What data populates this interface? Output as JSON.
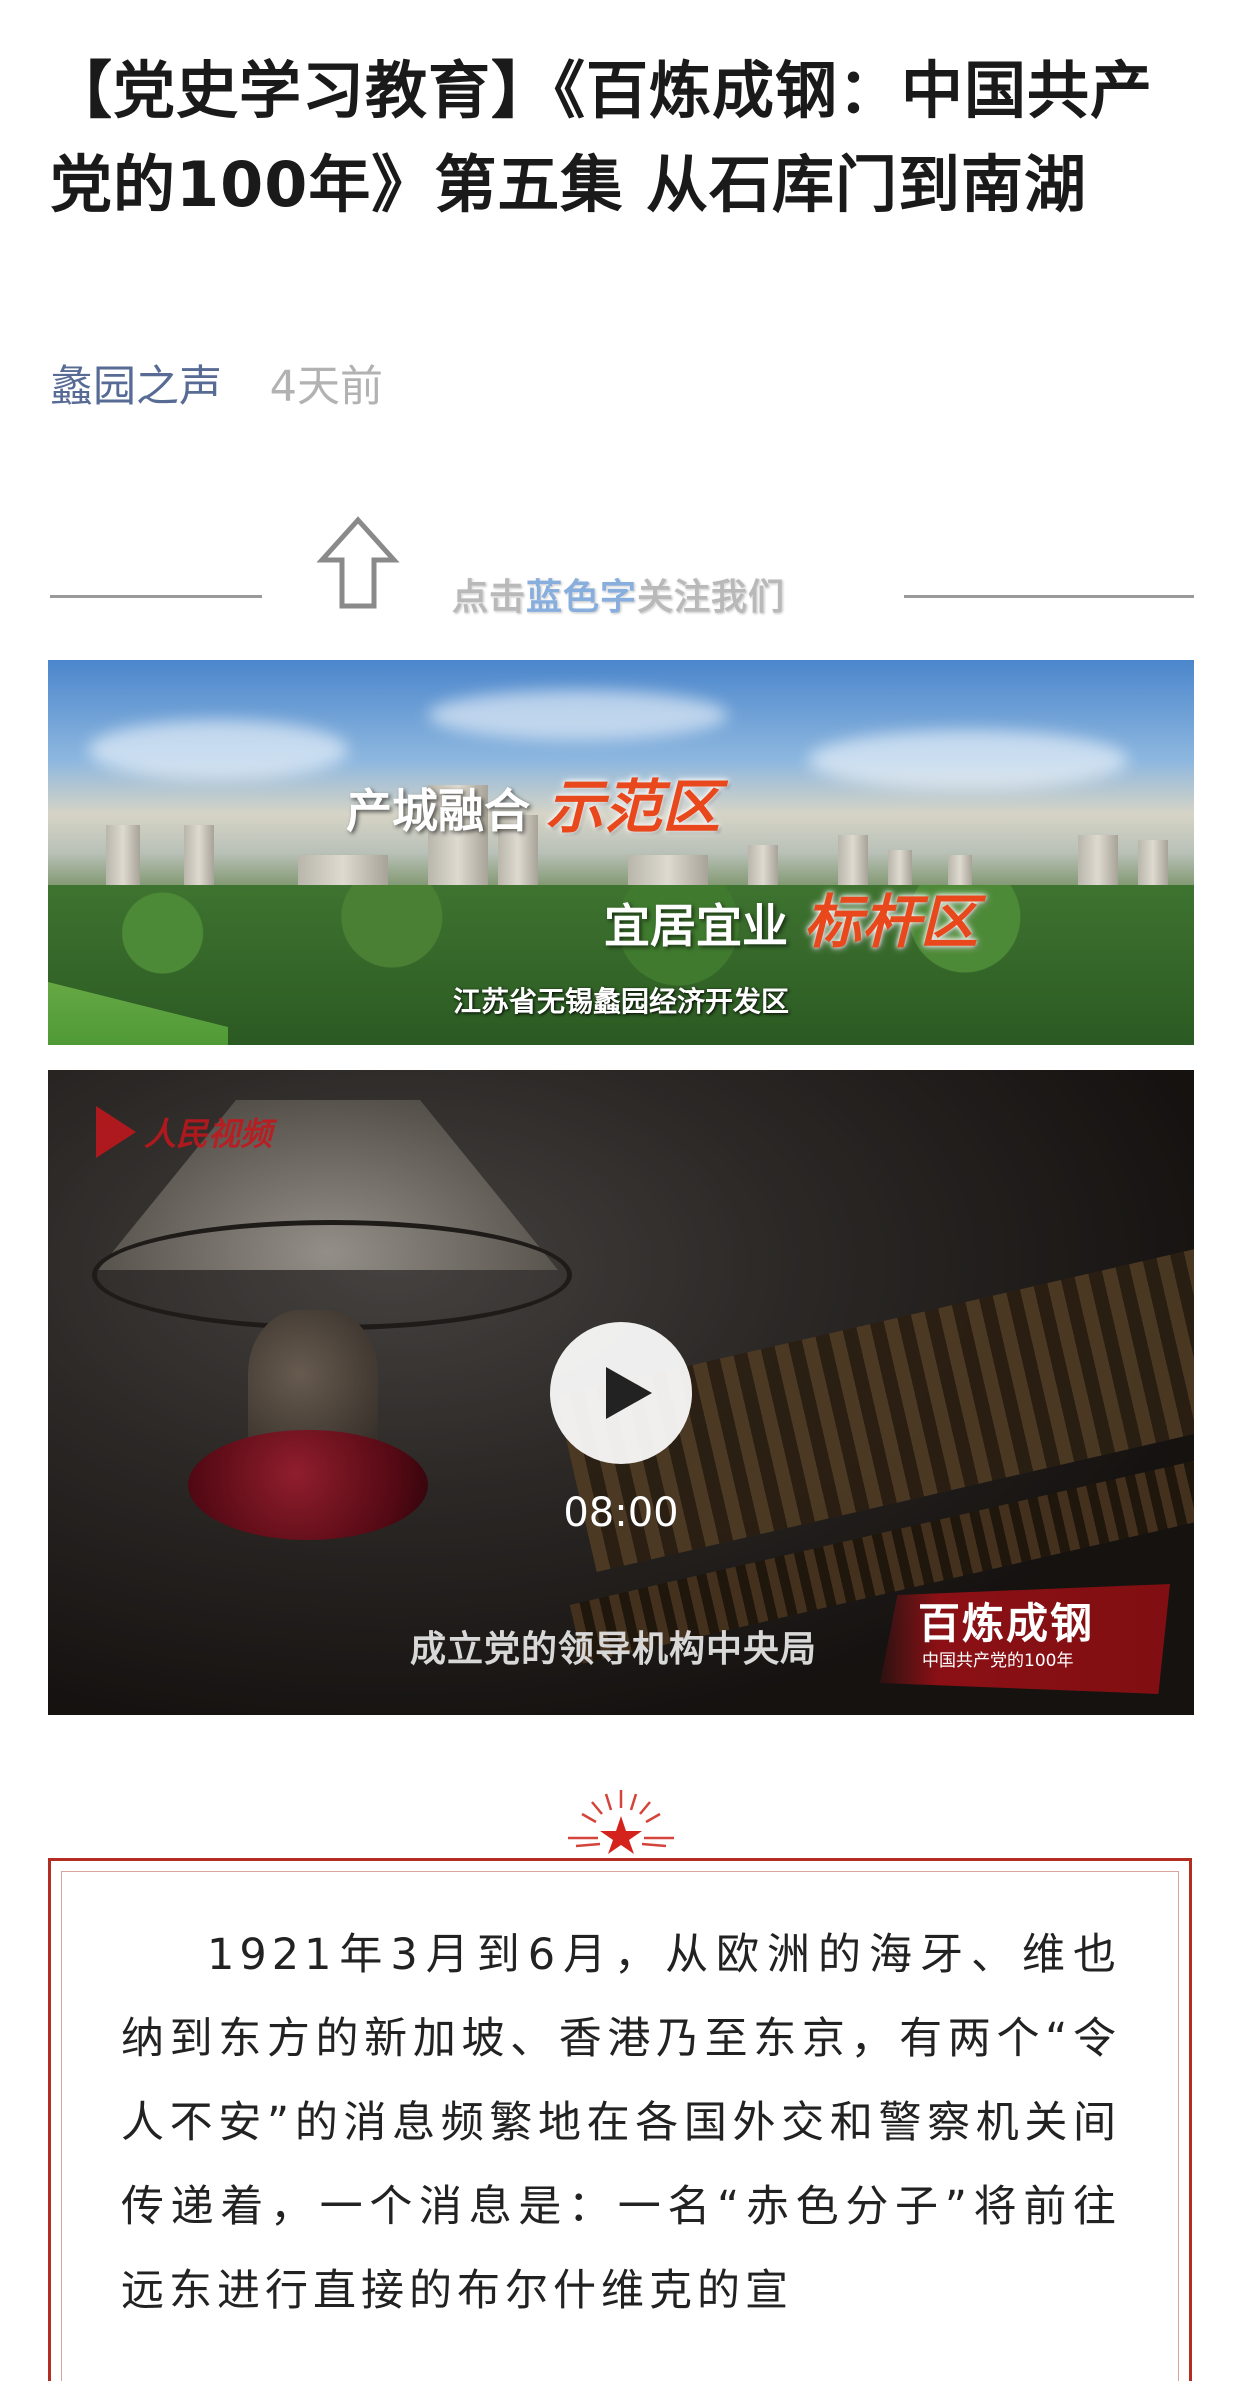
{
  "article": {
    "title": "【党史学习教育】《百炼成钢：中国共产党的100年》第五集 从石库门到南湖",
    "author": "蠡园之声",
    "time": "4天前"
  },
  "follow_banner": {
    "text_prefix": "点击",
    "text_blue": "蓝色字",
    "text_suffix": "关注我们"
  },
  "promo": {
    "line1_white": "产城融合",
    "line1_red": "示范区",
    "line2_white": "宜居宜业",
    "line2_red": "标杆区",
    "caption": "江苏省无锡蠡园经济开发区"
  },
  "video": {
    "logo_text": "人民视频",
    "duration": "08:00",
    "subtitle": "成立党的领导机构中央局",
    "series_title": "百炼成钢",
    "series_sub": "中国共产党的100年"
  },
  "body": {
    "paragraph": "1921年3月到6月，从欧洲的海牙、维也纳到东方的新加坡、香港乃至东京，有两个“令人不安”的消息频繁地在各国外交和警察机关间传递着，一个消息是：一名“赤色分子”将前往远东进行直接的布尔什维克的宣"
  },
  "colors": {
    "link_blue": "#576b95",
    "accent_red": "#b42d22"
  },
  "icons": [
    "up-arrow-icon",
    "play-icon",
    "star-ornament-icon"
  ]
}
